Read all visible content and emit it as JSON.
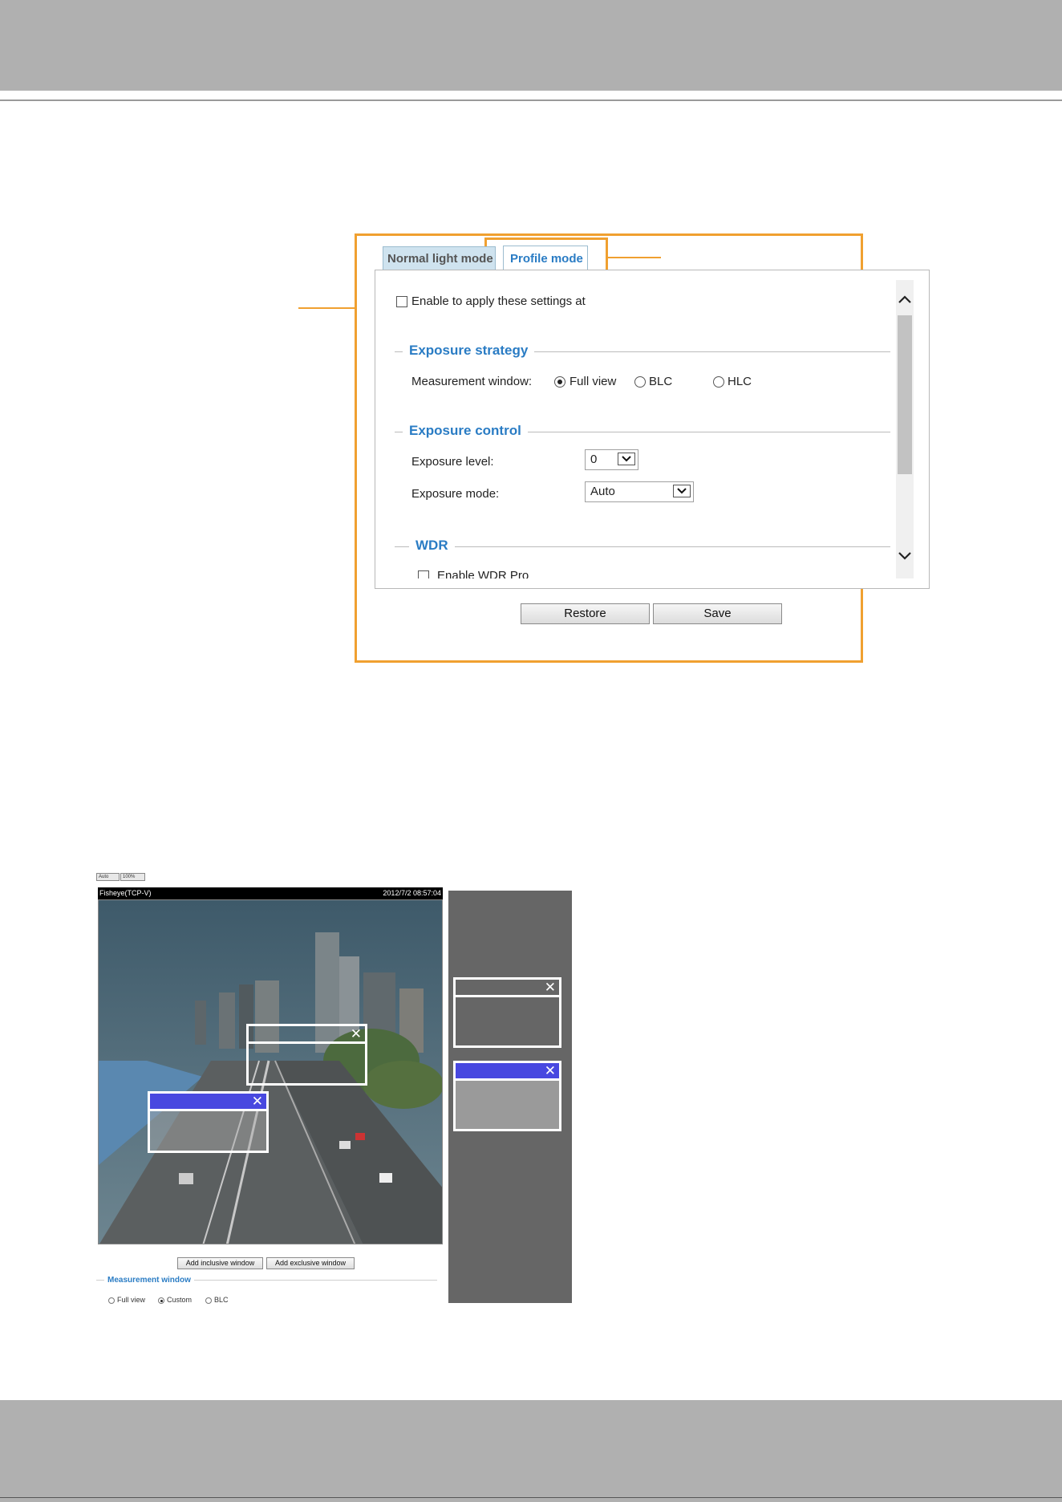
{
  "tabs": {
    "normal_light_mode": "Normal light mode",
    "profile_mode": "Profile mode"
  },
  "profile": {
    "enable_label": "Enable to apply these settings at",
    "exposure_strategy": {
      "title": "Exposure strategy",
      "measurement_label": "Measurement window:",
      "options": [
        "Full view",
        "BLC",
        "HLC"
      ],
      "selected": "Full view"
    },
    "exposure_control": {
      "title": "Exposure control",
      "level_label": "Exposure level:",
      "level_value": "0",
      "mode_label": "Exposure mode:",
      "mode_value": "Auto"
    },
    "wdr": {
      "title": "WDR",
      "enable_label": "Enable WDR Pro"
    }
  },
  "buttons": {
    "restore": "Restore",
    "save": "Save"
  },
  "camera": {
    "mini_buttons": [
      "Auto",
      "100%"
    ],
    "stream_name": "Fisheye(TCP-V)",
    "timestamp": "2012/7/2 08:57:04",
    "add_inclusive": "Add inclusive window",
    "add_exclusive": "Add exclusive window",
    "measurement_title": "Measurement window",
    "measurement_options": [
      "Full view",
      "Custom",
      "BLC"
    ],
    "measurement_selected": "Custom",
    "close_glyph": "✕"
  },
  "colors": {
    "callout": "#f0a030",
    "section_title": "#2a7cc4",
    "window_selected": "#4848e0",
    "page_band": "#b0b0b0"
  }
}
